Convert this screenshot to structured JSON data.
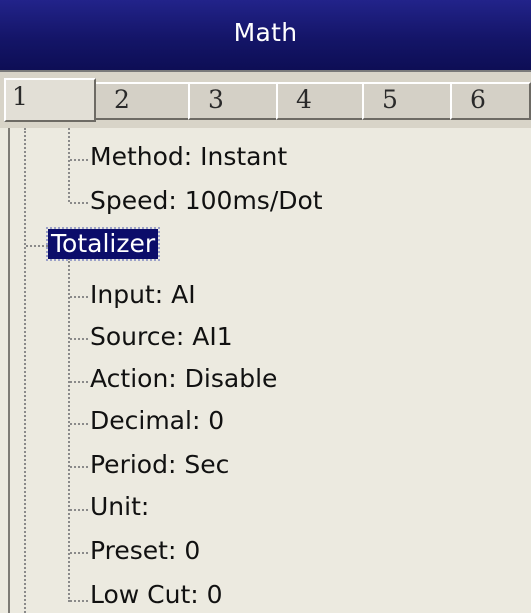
{
  "window": {
    "title": "Math"
  },
  "tabs": [
    {
      "label": "1",
      "active": true
    },
    {
      "label": "2",
      "active": false
    },
    {
      "label": "3",
      "active": false
    },
    {
      "label": "4",
      "active": false
    },
    {
      "label": "5",
      "active": false
    },
    {
      "label": "6",
      "active": false
    }
  ],
  "tree": {
    "prev_children": [
      {
        "label": "Method: Instant"
      },
      {
        "label": "Speed: 100ms/Dot"
      }
    ],
    "selected_node": {
      "label": "Totalizer"
    },
    "children": [
      {
        "label": "Input: AI"
      },
      {
        "label": "Source: AI1"
      },
      {
        "label": "Action: Disable"
      },
      {
        "label": "Decimal: 0"
      },
      {
        "label": "Period: Sec"
      },
      {
        "label": "Unit:"
      },
      {
        "label": "Preset: 0"
      },
      {
        "label": "Low Cut: 0"
      }
    ]
  },
  "colors": {
    "titlebar": "#141568",
    "selection": "#0c0d6a",
    "panel": "#eceae0"
  }
}
